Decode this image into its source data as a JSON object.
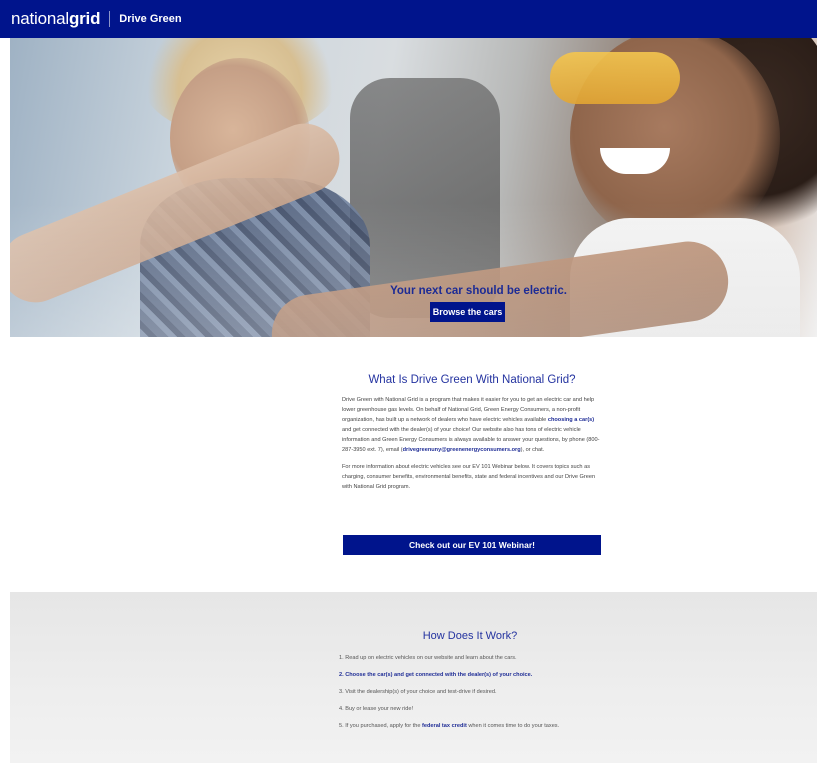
{
  "header": {
    "logo_light": "national",
    "logo_bold": "grid",
    "program_name": "Drive Green"
  },
  "hero": {
    "headline": "Your next car should be electric.",
    "button_label": "Browse the cars"
  },
  "what_is": {
    "title": "What Is Drive Green With National Grid?",
    "p1_before_link": "Drive Green with National Grid is a program that makes it easier for you to get an electric car and help lower greenhouse gas levels. On behalf of National Grid, Green Energy Consumers, a non-profit organization, has built up a network of dealers who have electric vehicles available ",
    "p1_link": "choosing a car(s)",
    "p1_after_link": " and get connected with the dealer(s) of your choice! Our website also has tons of electric vehicle information and Green Energy Consumers is always available to answer your questions, by phone (800-287-3950 ext. 7), email (",
    "p1_email": "drivegreenuny@greenenergyconsumers.org",
    "p1_after_email": "), or chat.",
    "p2": "For more information about electric vehicles see our EV 101 Webinar below. It covers topics such as charging, consumer benefits, environmental benefits, state and federal incentives and our Drive Green with National Grid program.",
    "webinar_button": "Check out our EV 101 Webinar!"
  },
  "how_it_works": {
    "title": "How Does It Work?",
    "steps": [
      "1. Read up on electric vehicles on our website and learn about the cars.",
      "2. Choose the car(s) and get connected with the dealer(s) of your choice.",
      "3. Visit the dealership(s) of your choice and test-drive if desired.",
      "4. Buy or lease your new ride!"
    ],
    "step5_before": "5. If you purchased, apply for the ",
    "step5_link": "federal tax credit",
    "step5_after": " when it comes time to do your taxes."
  }
}
